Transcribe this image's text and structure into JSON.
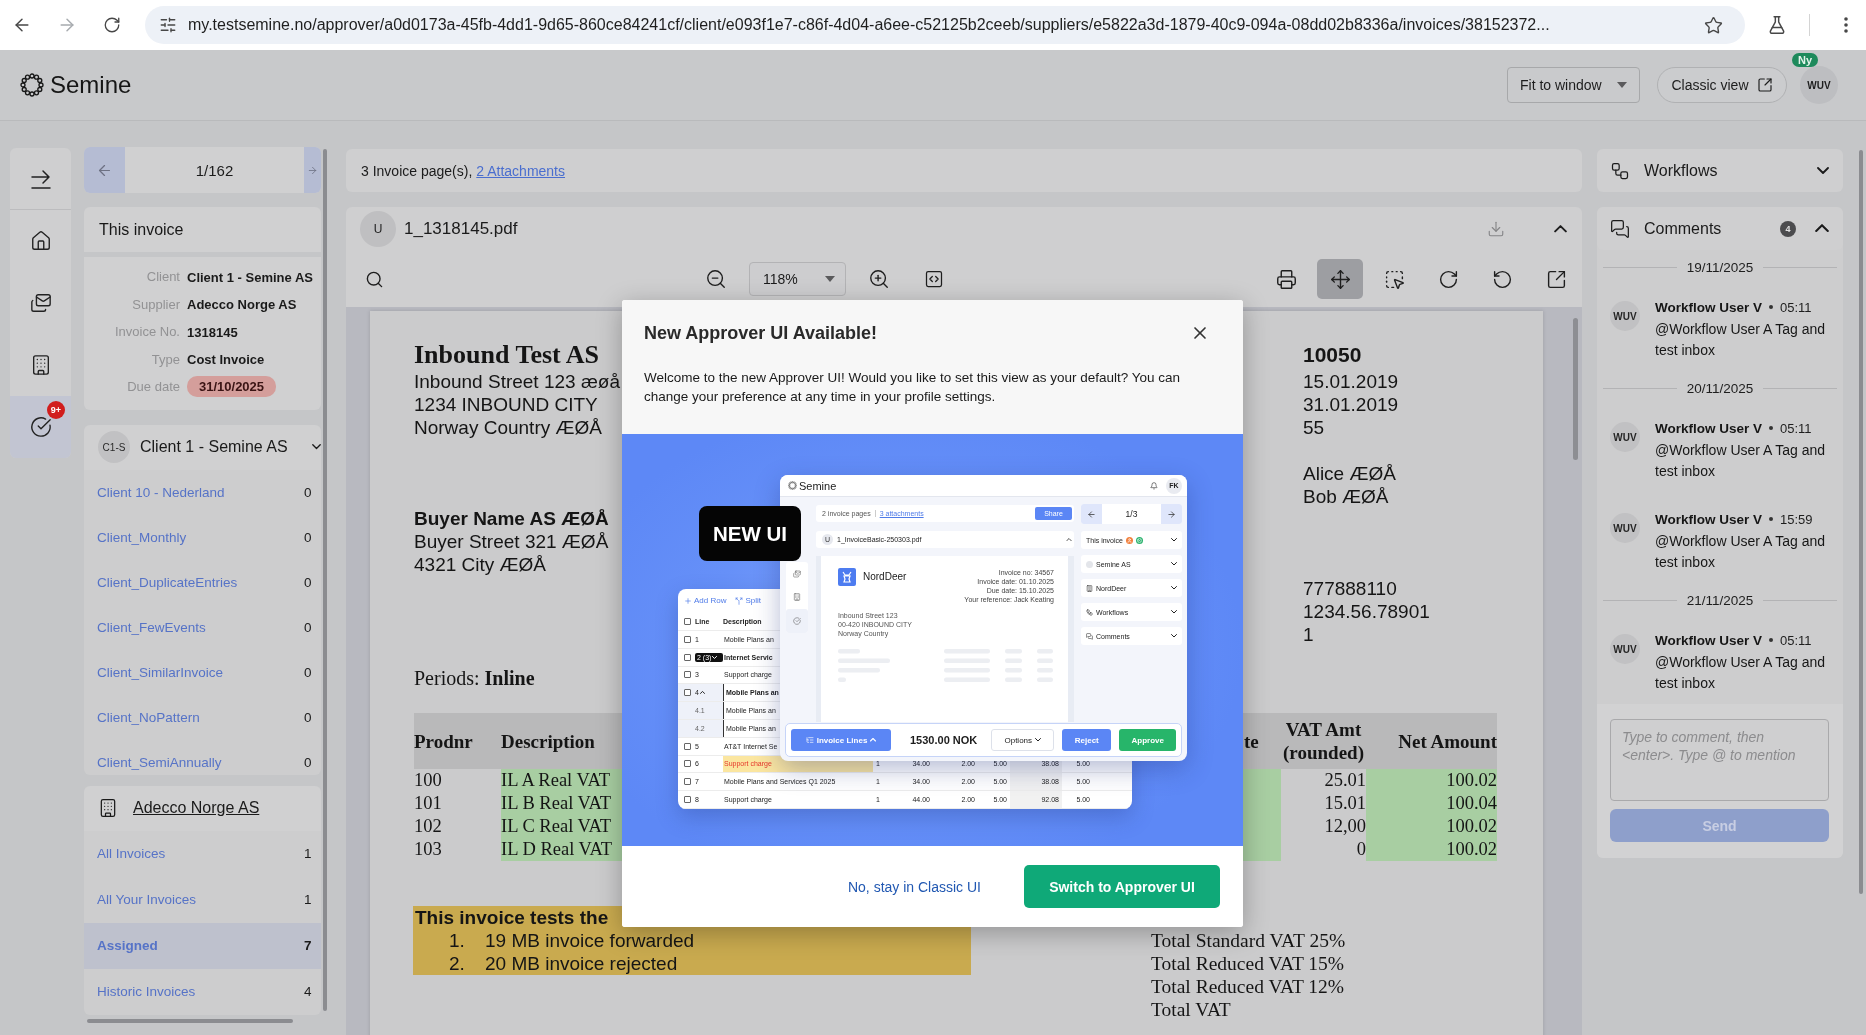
{
  "browser": {
    "url": "my.testsemine.no/approver/a0d0173a-45fb-4dd1-9d65-860ce84241cf/client/e093f1e7-c86f-4d04-a6ee-c52125b2ceeb/suppliers/e5822a3d-1879-40c9-094a-08dd02b8336a/invoices/38152372...",
    "forward_disabled": true
  },
  "header": {
    "logo": "Semine",
    "view_select": "Fit to window",
    "classic_button": "Classic view",
    "avatar": "WUV",
    "new_badge": "Ny"
  },
  "rail": {
    "items": [
      {
        "kind": "collapse",
        "selected": false
      },
      {
        "kind": "home",
        "selected": false
      },
      {
        "kind": "inbox",
        "selected": false
      },
      {
        "kind": "suppliers",
        "selected": false
      },
      {
        "kind": "tasks",
        "selected": true,
        "badge": "9+"
      }
    ]
  },
  "pager": {
    "position": "1/162"
  },
  "this_invoice": {
    "title": "This invoice",
    "fields": [
      {
        "label": "Client",
        "value": "Client 1 - Semine AS",
        "overdue": false
      },
      {
        "label": "Supplier",
        "value": "Adecco Norge AS",
        "overdue": false
      },
      {
        "label": "Invoice No.",
        "value": "1318145",
        "overdue": false
      },
      {
        "label": "Type",
        "value": "Cost Invoice",
        "overdue": false
      },
      {
        "label": "Due date",
        "value": "31/10/2025",
        "overdue": true
      }
    ]
  },
  "client_group": {
    "initials": "C1-S",
    "name": "Client 1 - Semine AS",
    "items": [
      {
        "label": "Client 10 - Nederland",
        "count": "0"
      },
      {
        "label": "Client_Monthly",
        "count": "0"
      },
      {
        "label": "Client_DuplicateEntries",
        "count": "0"
      },
      {
        "label": "Client_FewEvents",
        "count": "0"
      },
      {
        "label": "Client_SimilarInvoice",
        "count": "0"
      },
      {
        "label": "Client_NoPattern",
        "count": "0"
      },
      {
        "label": "Client_SemiAnnually",
        "count": "0"
      }
    ]
  },
  "supplier_group": {
    "name": "Adecco Norge AS",
    "items": [
      {
        "label": "All Invoices",
        "count": "1",
        "selected": false
      },
      {
        "label": "All Your Invoices",
        "count": "1",
        "selected": false
      },
      {
        "label": "Assigned",
        "count": "7",
        "selected": true
      },
      {
        "label": "Historic Invoices",
        "count": "4",
        "selected": false
      }
    ]
  },
  "viewer": {
    "pages_text": "3 Invoice page(s),",
    "attachments_link": "2 Attachments",
    "file": {
      "initial": "U",
      "name": "1_1318145.pdf"
    },
    "zoom": "118%",
    "tools": [
      {
        "kind": "print",
        "selected": false
      },
      {
        "kind": "pan",
        "selected": true
      },
      {
        "kind": "area",
        "selected": false
      },
      {
        "kind": "rotate_right",
        "selected": false
      },
      {
        "kind": "rotate_left",
        "selected": false
      },
      {
        "kind": "open_external",
        "selected": false
      }
    ]
  },
  "document": {
    "sender": {
      "name": "Inbound Test AS",
      "lines": [
        "Inbound Street 123 æøå",
        "1234 INBOUND CITY",
        "Norway Country ÆØÅ"
      ]
    },
    "buyer": {
      "name": "Buyer Name AS ÆØÅ",
      "lines": [
        "Buyer Street 321 ÆØÅ",
        "4321 City ÆØÅ"
      ]
    },
    "invoice_number": "10050",
    "dates": [
      "15.01.2019",
      "31.01.2019",
      "55"
    ],
    "contacts": [
      "Alice ÆØÅ",
      "Bob ÆØÅ"
    ],
    "accounts": [
      "777888110",
      "1234.56.78901",
      "1"
    ],
    "periods": "Periods: **Inline**",
    "table": {
      "columns": {
        "prodnr": "Prodnr",
        "description": "Description",
        "column_3": "te",
        "vat_amount": "VAT Amt\n(rounded)",
        "net_amount": "Net Amount"
      },
      "rows": [
        {
          "prodnr": "100",
          "description": "IL A Real VAT",
          "vat_amount": "25.01",
          "net_amount": "100.02"
        },
        {
          "prodnr": "101",
          "description": "IL B Real VAT",
          "vat_amount": "15.01",
          "net_amount": "100.04"
        },
        {
          "prodnr": "102",
          "description": "IL C Real VAT",
          "vat_amount": "12,00",
          "net_amount": "100.02"
        },
        {
          "prodnr": "103",
          "description": "IL D Real VAT",
          "vat_amount": "0",
          "net_amount": "100.02"
        }
      ]
    },
    "note": {
      "title": "This invoice tests the",
      "items": [
        {
          "number": "1.",
          "text": "19 MB invoice forwarded"
        },
        {
          "number": "2.",
          "text": "20 MB invoice rejected"
        }
      ]
    },
    "totals": [
      "Total Standard VAT 25%",
      "Total Reduced VAT 15%",
      "Total Reduced VAT 12%",
      "Total VAT"
    ]
  },
  "modal": {
    "title": "New Approver UI Available!",
    "message": "Welcome to the new Approver UI! Would you like to set this view as your default? You can change your preference at any time in your profile settings.",
    "illustration": {
      "badge": "NEW UI",
      "window": {
        "logo": "Semine",
        "avatar": "FK",
        "rail": [
          {
            "kind": "inbox",
            "selected": false
          },
          {
            "kind": "suppliers",
            "selected": false
          },
          {
            "kind": "tasks",
            "selected": true
          }
        ],
        "pages_text": "2 invoice pages",
        "attachments_link": "3 attachments",
        "share": "Share",
        "file_initial": "U",
        "file_name": "1_InvoiceBasic-250303.pdf",
        "doc": {
          "company": "NordDeer",
          "meta": [
            "Invoice no: 34567",
            "Invoice date: 01.10.2025",
            "Due date: 15.10.2025",
            "Your reference: Jack Keating"
          ],
          "address": [
            "Inbound Street 123",
            "00-420 INBOUND CITY",
            "Norway Country"
          ]
        },
        "pager": "1/3",
        "sections": [
          {
            "kind": "invoice",
            "label": "This invoice"
          },
          {
            "kind": "client",
            "label": "Semine AS"
          },
          {
            "kind": "supplier",
            "label": "NordDeer"
          },
          {
            "kind": "workflows",
            "label": "Workflows"
          },
          {
            "kind": "comments",
            "label": "Comments"
          }
        ],
        "footer": {
          "lines_button": "Invoice Lines",
          "amount": "1530.00 NOK",
          "options": "Options",
          "reject": "Reject",
          "approve": "Approve"
        }
      },
      "table": {
        "add_row": "Add Row",
        "split": "Split",
        "all_checked": false,
        "columns": [
          "Line",
          "Description"
        ],
        "rows": [
          {
            "kind": "plain",
            "checked": false,
            "line": "1",
            "description": "Mobile Plans an"
          },
          {
            "kind": "group",
            "checked": false,
            "line": "2 (3)",
            "description": "Internet Servic"
          },
          {
            "kind": "plain",
            "checked": false,
            "line": "3",
            "description": "Support charge"
          },
          {
            "kind": "parent",
            "checked": false,
            "line": "4",
            "description": "Mobile Plans an"
          },
          {
            "kind": "child",
            "line": "4.1",
            "description": "Mobile Plans an"
          },
          {
            "kind": "child",
            "line": "4.2",
            "description": "Mobile Plans an"
          },
          {
            "kind": "plain",
            "checked": false,
            "line": "5",
            "description": "AT&T Internet Se"
          },
          {
            "kind": "flagged",
            "checked": false,
            "line": "6",
            "description": "Support charge",
            "cells": [
              "1",
              "34.00",
              "2.00",
              "5.00",
              "38.08",
              "5.00"
            ]
          },
          {
            "kind": "plain",
            "checked": false,
            "line": "7",
            "description": "Mobile Plans and Services Q1 2025",
            "cells": [
              "1",
              "34.00",
              "2.00",
              "5.00",
              "38.08",
              "5.00"
            ]
          },
          {
            "kind": "plain",
            "checked": false,
            "line": "8",
            "description": "Support charge",
            "cells": [
              "1",
              "44.00",
              "2.00",
              "5.00",
              "92.08",
              "5.00"
            ]
          }
        ]
      }
    },
    "decline": "No, stay in Classic UI",
    "accept": "Switch to Approver UI"
  },
  "workflows": {
    "title": "Workflows",
    "expanded": false
  },
  "comments": {
    "title": "Comments",
    "count": "4",
    "expanded": true,
    "groups": [
      {
        "date": "19/11/2025",
        "items": [
          {
            "avatar": "WUV",
            "author": "Workflow User V",
            "time": "05:11",
            "text": "@Workflow User A Tag and test inbox"
          }
        ]
      },
      {
        "date": "20/11/2025",
        "items": [
          {
            "avatar": "WUV",
            "author": "Workflow User V",
            "time": "05:11",
            "text": "@Workflow User A Tag and test inbox"
          },
          {
            "avatar": "WUV",
            "author": "Workflow User V",
            "time": "15:59",
            "text": "@Workflow User A Tag and test inbox"
          }
        ]
      },
      {
        "date": "21/11/2025",
        "items": [
          {
            "avatar": "WUV",
            "author": "Workflow User V",
            "time": "05:11",
            "text": "@Workflow User A Tag and test inbox"
          }
        ]
      }
    ],
    "input": {
      "placeholder": "Type to comment, then <enter>. Type @ to mention"
    },
    "send": {
      "label": "Send",
      "disabled": true
    }
  }
}
